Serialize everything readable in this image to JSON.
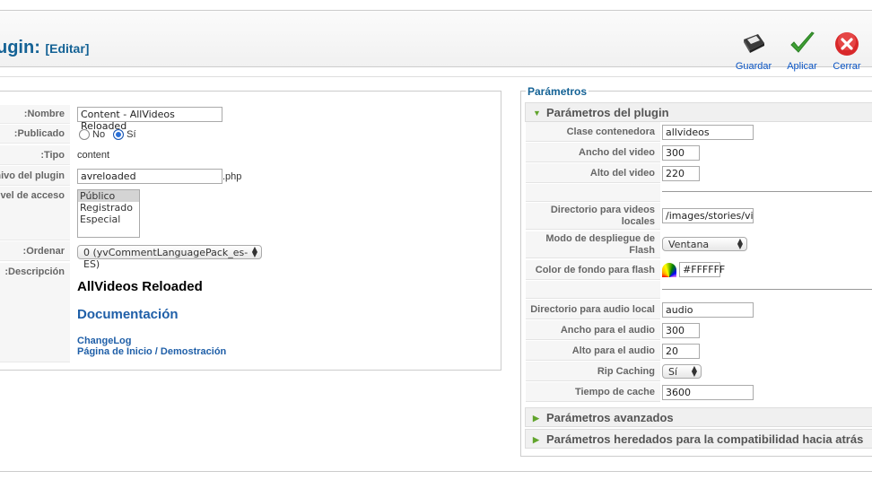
{
  "header": {
    "title": "ugin:",
    "edit_label": "[Editar]",
    "toolbar": {
      "save_label": "Guardar",
      "apply_label": "Aplicar",
      "cancel_label": "Cerrar"
    }
  },
  "details": {
    "name_label": "Nombre:",
    "name_value": "Content - AllVideos Reloaded",
    "published_label": "Publicado:",
    "published_options": [
      "No",
      "Sí"
    ],
    "published_selected": "Sí",
    "type_label": "Tipo:",
    "type_value": "content",
    "file_label": "Archivo del plugin:",
    "file_value": "avreloaded",
    "file_ext": ".php",
    "access_label": "Nivel de acceso:",
    "access_options": [
      "Público",
      "Registrado",
      "Especial"
    ],
    "access_selected": "Público",
    "order_label": "Ordenar:",
    "order_value": "0 (yvCommentLanguagePack_es-ES)",
    "description_label": "Descripción:",
    "desc_title": "AllVideos Reloaded",
    "desc_doc": "Documentación",
    "desc_changelog": "ChangeLog",
    "desc_home": "Página de Inicio / Demostración"
  },
  "params": {
    "legend": "Parámetros",
    "section_plugin": "Parámetros del plugin",
    "section_advanced": "Parámetros avanzados",
    "section_legacy": "Parámetros heredados para la compatibilidad hacia atrás",
    "container_class_label": "Clase contenedora",
    "container_class_value": "allvideos",
    "video_width_label": "Ancho del video",
    "video_width_value": "300",
    "video_height_label": "Alto del video",
    "video_height_value": "220",
    "video_dir_label": "Directorio para videos locales",
    "video_dir_value": "/images/stories/vid",
    "flash_mode_label": "Modo de despliegue de Flash",
    "flash_mode_value": "Ventana",
    "flash_bg_label": "Color de fondo para flash",
    "flash_bg_value": "#FFFFFF",
    "audio_dir_label": "Directorio para audio local",
    "audio_dir_value": "audio",
    "audio_width_label": "Ancho para el audio",
    "audio_width_value": "300",
    "audio_height_label": "Alto para el audio",
    "audio_height_value": "20",
    "rip_caching_label": "Rip Caching",
    "rip_caching_value": "Sí",
    "cache_time_label": "Tiempo de cache",
    "cache_time_value": "3600"
  },
  "icons": {
    "save": "floppy-disk-icon",
    "apply": "checkmark-icon",
    "cancel": "close-icon",
    "color": "rainbow-color-icon"
  }
}
